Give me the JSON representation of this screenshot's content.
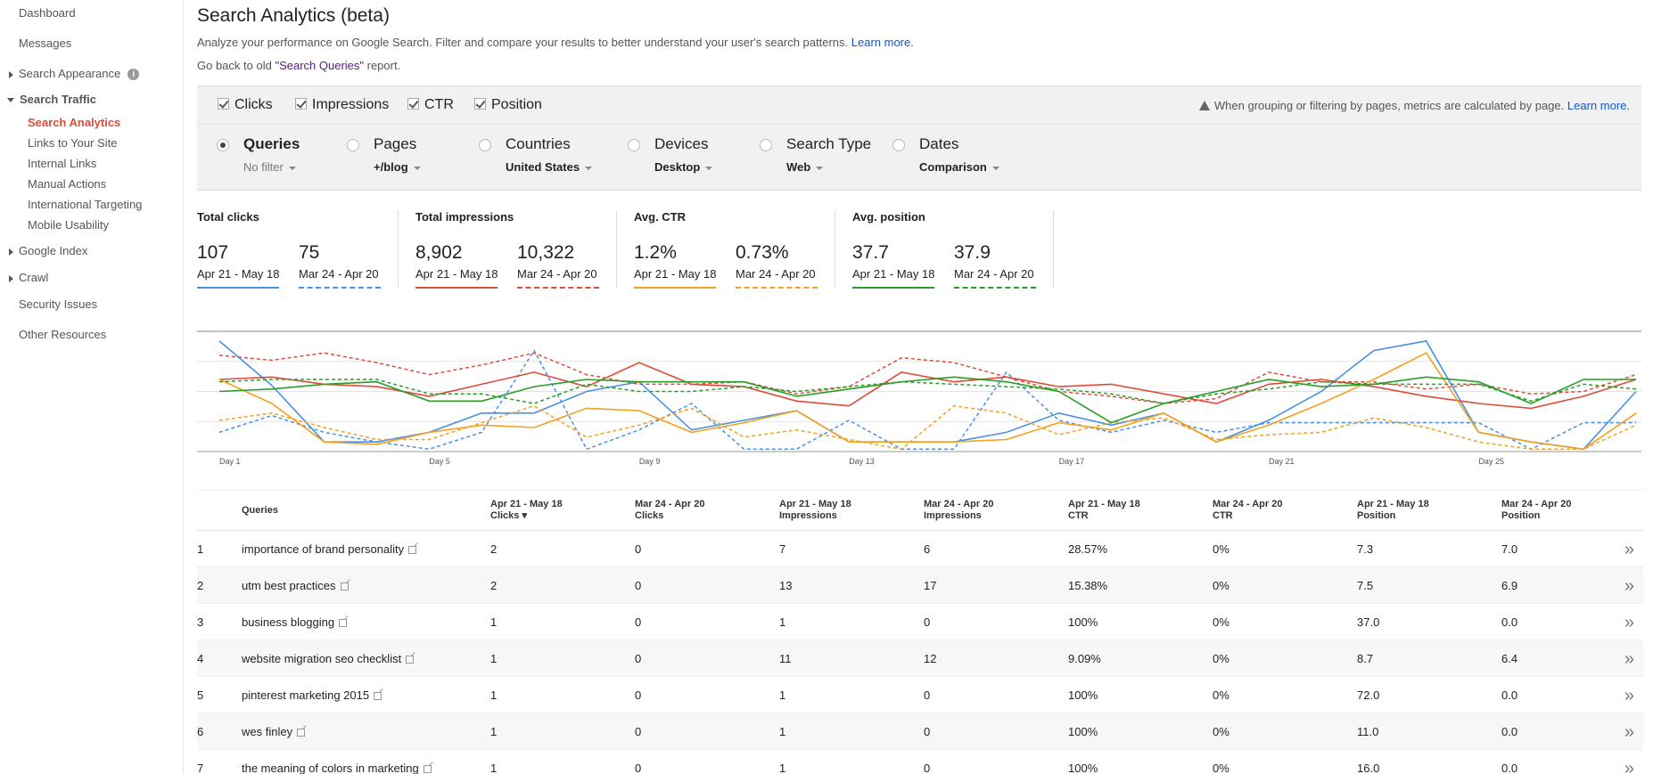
{
  "sidebar": {
    "dashboard": "Dashboard",
    "messages": "Messages",
    "search_appearance": "Search Appearance",
    "search_traffic": "Search Traffic",
    "sub": [
      "Search Analytics",
      "Links to Your Site",
      "Internal Links",
      "Manual Actions",
      "International Targeting",
      "Mobile Usability"
    ],
    "google_index": "Google Index",
    "crawl": "Crawl",
    "security_issues": "Security Issues",
    "other_resources": "Other Resources"
  },
  "header": {
    "title": "Search Analytics (beta)",
    "description": "Analyze your performance on Google Search. Filter and compare your results to better understand your user's search patterns.",
    "learn_more": "Learn more.",
    "go_back_prefix": "Go back to old ",
    "go_back_link": "\"Search Queries\"",
    "go_back_suffix": " report."
  },
  "metrics": {
    "clicks": "Clicks",
    "impressions": "Impressions",
    "ctr": "CTR",
    "position": "Position",
    "note": "When grouping or filtering by pages, metrics are calculated by page.",
    "note_link": "Learn more."
  },
  "filters": [
    {
      "name": "Queries",
      "value": "No filter",
      "selected": true
    },
    {
      "name": "Pages",
      "value": "+/blog",
      "selected": false
    },
    {
      "name": "Countries",
      "value": "United States",
      "selected": false
    },
    {
      "name": "Devices",
      "value": "Desktop",
      "selected": false
    },
    {
      "name": "Search Type",
      "value": "Web",
      "selected": false
    },
    {
      "name": "Dates",
      "value": "Comparison",
      "selected": false
    }
  ],
  "summary": [
    {
      "title": "Total clicks",
      "a": "107",
      "a_range": "Apr 21 - May 18",
      "b": "75",
      "b_range": "Mar 24 - Apr 20",
      "color": "#4a90e2"
    },
    {
      "title": "Total impressions",
      "a": "8,902",
      "a_range": "Apr 21 - May 18",
      "b": "10,322",
      "b_range": "Mar 24 - Apr 20",
      "color": "#dd4b39"
    },
    {
      "title": "Avg. CTR",
      "a": "1.2%",
      "a_range": "Apr 21 - May 18",
      "b": "0.73%",
      "b_range": "Mar 24 - Apr 20",
      "color": "#f4a020"
    },
    {
      "title": "Avg. position",
      "a": "37.7",
      "a_range": "Apr 21 - May 18",
      "b": "37.9",
      "b_range": "Mar 24 - Apr 20",
      "color": "#2a9d2a"
    }
  ],
  "chart_data": {
    "type": "line",
    "x_labels": [
      "Day 1",
      "Day 5",
      "Day 9",
      "Day 13",
      "Day 17",
      "Day 21",
      "Day 25"
    ],
    "x_label_positions": [
      1,
      5,
      9,
      13,
      17,
      21,
      25
    ],
    "num_points": 28,
    "ylim": [
      0,
      100
    ],
    "series": [
      {
        "metric": "clicks",
        "period": "current",
        "color": "#4a90e2",
        "dashed": false,
        "values": [
          92,
          55,
          8,
          8,
          16,
          32,
          32,
          50,
          58,
          18,
          26,
          34,
          8,
          8,
          8,
          16,
          32,
          22,
          32,
          8,
          26,
          50,
          84,
          92,
          16,
          8,
          2,
          50
        ]
      },
      {
        "metric": "clicks",
        "period": "previous",
        "color": "#4a90e2",
        "dashed": true,
        "values": [
          16,
          30,
          16,
          8,
          2,
          16,
          84,
          2,
          18,
          40,
          2,
          2,
          26,
          2,
          2,
          66,
          26,
          16,
          26,
          16,
          24,
          24,
          24,
          24,
          24,
          2,
          24,
          24
        ]
      },
      {
        "metric": "impressions",
        "period": "current",
        "color": "#dd4b39",
        "dashed": false,
        "values": [
          60,
          62,
          56,
          54,
          46,
          56,
          66,
          54,
          74,
          56,
          54,
          42,
          38,
          66,
          58,
          62,
          54,
          56,
          48,
          40,
          56,
          60,
          54,
          46,
          40,
          36,
          46,
          60
        ]
      },
      {
        "metric": "impressions",
        "period": "previous",
        "color": "#dd4b39",
        "dashed": true,
        "values": [
          80,
          76,
          82,
          74,
          64,
          72,
          82,
          64,
          56,
          56,
          58,
          48,
          54,
          78,
          74,
          62,
          50,
          46,
          40,
          44,
          66,
          58,
          58,
          52,
          56,
          48,
          50,
          64
        ]
      },
      {
        "metric": "ctr",
        "period": "current",
        "color": "#f4a020",
        "dashed": false,
        "values": [
          60,
          40,
          8,
          6,
          16,
          22,
          20,
          36,
          34,
          16,
          24,
          34,
          8,
          8,
          8,
          10,
          24,
          18,
          32,
          8,
          22,
          40,
          60,
          82,
          16,
          8,
          2,
          32
        ]
      },
      {
        "metric": "ctr",
        "period": "previous",
        "color": "#f4a020",
        "dashed": true,
        "values": [
          26,
          32,
          20,
          10,
          10,
          24,
          38,
          12,
          22,
          36,
          12,
          18,
          10,
          2,
          38,
          32,
          14,
          24,
          28,
          10,
          14,
          16,
          28,
          20,
          8,
          2,
          2,
          22
        ]
      },
      {
        "metric": "position",
        "period": "current",
        "color": "#2a9d2a",
        "dashed": false,
        "values": [
          50,
          52,
          56,
          58,
          42,
          42,
          54,
          60,
          58,
          58,
          58,
          46,
          52,
          58,
          62,
          58,
          50,
          24,
          40,
          50,
          60,
          54,
          56,
          62,
          58,
          40,
          60,
          60
        ]
      },
      {
        "metric": "position",
        "period": "previous",
        "color": "#2a9d2a",
        "dashed": true,
        "values": [
          58,
          60,
          60,
          60,
          48,
          48,
          40,
          56,
          50,
          50,
          54,
          50,
          54,
          58,
          56,
          54,
          52,
          48,
          40,
          48,
          52,
          58,
          56,
          56,
          56,
          42,
          56,
          52
        ]
      }
    ]
  },
  "table": {
    "headers": [
      {
        "line1": "",
        "line2": "Queries"
      },
      {
        "line1": "Apr 21 - May 18",
        "line2": "Clicks ▾"
      },
      {
        "line1": "Mar 24 - Apr 20",
        "line2": "Clicks"
      },
      {
        "line1": "Apr 21 - May 18",
        "line2": "Impressions"
      },
      {
        "line1": "Mar 24 - Apr 20",
        "line2": "Impressions"
      },
      {
        "line1": "Apr 21 - May 18",
        "line2": "CTR"
      },
      {
        "line1": "Mar 24 - Apr 20",
        "line2": "CTR"
      },
      {
        "line1": "Apr 21 - May 18",
        "line2": "Position"
      },
      {
        "line1": "Mar 24 - Apr 20",
        "line2": "Position"
      }
    ],
    "rows": [
      {
        "n": "1",
        "query": "importance of brand personality",
        "c1": "2",
        "c2": "0",
        "i1": "7",
        "i2": "6",
        "ctr1": "28.57%",
        "ctr2": "0%",
        "p1": "7.3",
        "p2": "7.0"
      },
      {
        "n": "2",
        "query": "utm best practices",
        "c1": "2",
        "c2": "0",
        "i1": "13",
        "i2": "17",
        "ctr1": "15.38%",
        "ctr2": "0%",
        "p1": "7.5",
        "p2": "6.9"
      },
      {
        "n": "3",
        "query": "business blogging",
        "c1": "1",
        "c2": "0",
        "i1": "1",
        "i2": "0",
        "ctr1": "100%",
        "ctr2": "0%",
        "p1": "37.0",
        "p2": "0.0"
      },
      {
        "n": "4",
        "query": "website migration seo checklist",
        "c1": "1",
        "c2": "0",
        "i1": "11",
        "i2": "12",
        "ctr1": "9.09%",
        "ctr2": "0%",
        "p1": "8.7",
        "p2": "6.4"
      },
      {
        "n": "5",
        "query": "pinterest marketing 2015",
        "c1": "1",
        "c2": "0",
        "i1": "1",
        "i2": "0",
        "ctr1": "100%",
        "ctr2": "0%",
        "p1": "72.0",
        "p2": "0.0"
      },
      {
        "n": "6",
        "query": "wes finley",
        "c1": "1",
        "c2": "0",
        "i1": "1",
        "i2": "0",
        "ctr1": "100%",
        "ctr2": "0%",
        "p1": "11.0",
        "p2": "0.0"
      },
      {
        "n": "7",
        "query": "the meaning of colors in marketing",
        "c1": "1",
        "c2": "0",
        "i1": "1",
        "i2": "0",
        "ctr1": "100%",
        "ctr2": "0%",
        "p1": "16.0",
        "p2": "0.0"
      }
    ],
    "row_action_icon": "double-chevron-right-icon",
    "row_action_glyph": "»"
  }
}
